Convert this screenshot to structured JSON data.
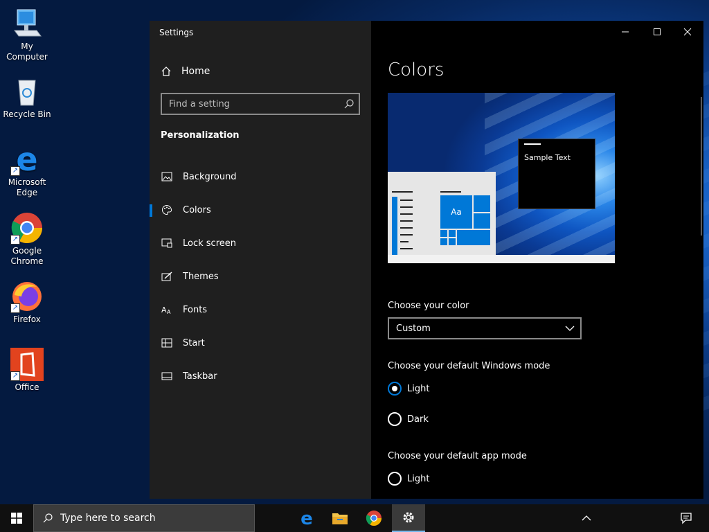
{
  "desktop": {
    "icons": [
      {
        "label": "My Computer"
      },
      {
        "label": "Recycle Bin"
      },
      {
        "label": "Microsoft Edge"
      },
      {
        "label": "Google Chrome"
      },
      {
        "label": "Firefox"
      },
      {
        "label": "Office"
      }
    ]
  },
  "window": {
    "title": "Settings",
    "home_label": "Home",
    "search_placeholder": "Find a setting",
    "section_heading": "Personalization",
    "nav_items": [
      {
        "label": "Background",
        "icon": "picture-icon"
      },
      {
        "label": "Colors",
        "icon": "palette-icon",
        "active": true
      },
      {
        "label": "Lock screen",
        "icon": "lock-screen-icon"
      },
      {
        "label": "Themes",
        "icon": "themes-icon"
      },
      {
        "label": "Fonts",
        "icon": "fonts-icon"
      },
      {
        "label": "Start",
        "icon": "start-icon"
      },
      {
        "label": "Taskbar",
        "icon": "taskbar-icon"
      }
    ]
  },
  "content": {
    "page_title": "Colors",
    "preview_sample_text": "Sample Text",
    "preview_tile_text": "Aa",
    "choose_color_label": "Choose your color",
    "color_dropdown_value": "Custom",
    "windows_mode_label": "Choose your default Windows mode",
    "windows_mode_options": [
      {
        "label": "Light",
        "selected": true
      },
      {
        "label": "Dark",
        "selected": false
      }
    ],
    "app_mode_label": "Choose your default app mode",
    "app_mode_options": [
      {
        "label": "Light",
        "selected": false
      }
    ]
  },
  "taskbar": {
    "search_placeholder": "Type here to search",
    "apps": [
      "edge-icon",
      "file-explorer-icon",
      "chrome-icon",
      "settings-gear-icon"
    ],
    "active_app": "settings-gear-icon"
  },
  "colors": {
    "accent": "#0078d7",
    "nav_background": "#1f1f1f",
    "content_background": "#000000"
  }
}
